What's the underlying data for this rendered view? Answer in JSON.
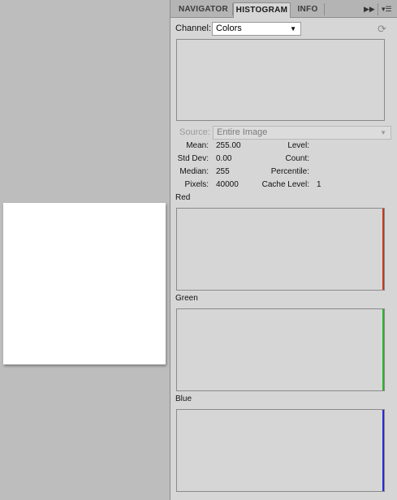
{
  "tabs": [
    {
      "label": "NAVIGATOR"
    },
    {
      "label": "HISTOGRAM"
    },
    {
      "label": "INFO"
    }
  ],
  "channel": {
    "label": "Channel:",
    "value": "Colors"
  },
  "source": {
    "label": "Source:",
    "value": "Entire Image"
  },
  "stats": {
    "mean_label": "Mean:",
    "mean": "255.00",
    "stddev_label": "Std Dev:",
    "stddev": "0.00",
    "median_label": "Median:",
    "median": "255",
    "pixels_label": "Pixels:",
    "pixels": "40000",
    "level_label": "Level:",
    "level": "",
    "count_label": "Count:",
    "count": "",
    "percentile_label": "Percentile:",
    "percentile": "",
    "cache_label": "Cache Level:",
    "cache": "1"
  },
  "channels": {
    "red": {
      "label": "Red",
      "color": "#c03a1c"
    },
    "green": {
      "label": "Green",
      "color": "#2eb12e"
    },
    "blue": {
      "label": "Blue",
      "color": "#2a2ad0"
    }
  },
  "icons": {
    "expand": "double-arrow-icon",
    "menu": "panel-menu-icon",
    "refresh": "refresh-icon",
    "dropdown": "chevron-down-icon"
  }
}
